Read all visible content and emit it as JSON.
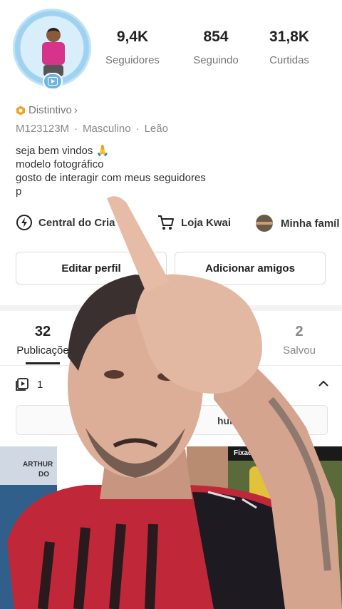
{
  "profile": {
    "stats": [
      {
        "value": "9,4K",
        "label": "Seguidores"
      },
      {
        "value": "854",
        "label": "Seguindo"
      },
      {
        "value": "31,8K",
        "label": "Curtidas"
      }
    ],
    "badge": "Distintivo",
    "badge_chevron": "›",
    "meta": {
      "id": "M123123M",
      "gender": "Masculino",
      "sign": "Leão",
      "separator": "·"
    },
    "bio": [
      "seja bem vindos 🙏",
      "modelo fotográfico",
      "gosto de interagir com meus seguidores",
      "p"
    ]
  },
  "shortcuts": [
    {
      "label": "Central do Cria",
      "icon": "lightning-circle-icon"
    },
    {
      "label": "Loja Kwai",
      "icon": "shopping-cart-icon"
    },
    {
      "label": "Minha famíl",
      "icon": "family-avatar-icon"
    }
  ],
  "actions": {
    "edit": "Editar perfil",
    "add_friends": "Adicionar amigos"
  },
  "tabs": [
    {
      "count": "32",
      "label": "Publicaçõe"
    },
    {
      "count": "2",
      "label": "Salvou"
    }
  ],
  "playlist": {
    "count_prefix": "1"
  },
  "search": {
    "text": "hurilohu"
  },
  "thumbnails": [
    {
      "label": "ARTHUR",
      "sublabel": "DO"
    },
    {
      "label": ""
    },
    {
      "label": "Fixado no to"
    }
  ],
  "colors": {
    "badge_orange": "#f0a020",
    "accent": "#222222",
    "muted": "#777777"
  }
}
